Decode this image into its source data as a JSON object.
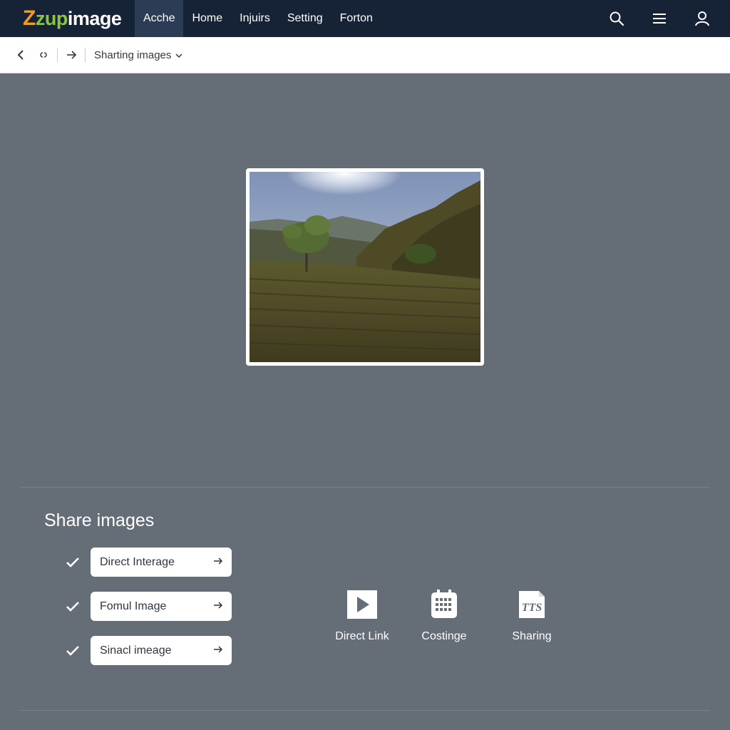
{
  "app": {
    "logo_z": "Z",
    "logo_zup": "zup",
    "logo_image": "image",
    "colors": {
      "topbar": "#162236",
      "active_tab": "#2c3c55",
      "logo_orange": "#f39a1e",
      "logo_green": "#8cc63f",
      "background": "#656d77"
    }
  },
  "nav": {
    "items": [
      {
        "label": "Acche",
        "active": true
      },
      {
        "label": "Home",
        "active": false
      },
      {
        "label": "Injuirs",
        "active": false
      },
      {
        "label": "Setting",
        "active": false
      },
      {
        "label": "Forton",
        "active": false
      }
    ],
    "icons": [
      "search-icon",
      "menu-icon",
      "user-icon"
    ]
  },
  "toolbar": {
    "icons": [
      "back-arrow-icon",
      "link-icon",
      "forward-arrow-icon"
    ],
    "breadcrumb": "Sharting images"
  },
  "share": {
    "title": "Share images",
    "options": [
      {
        "label": "Direct Interage",
        "checked": true
      },
      {
        "label": "Fomul Image",
        "checked": true
      },
      {
        "label": "Sinacl imeage",
        "checked": true
      }
    ],
    "actions": [
      {
        "label": "Direct Link",
        "icon": "play-icon"
      },
      {
        "label": "Costinge",
        "icon": "calendar-grid-icon"
      },
      {
        "label": "Sharing",
        "icon": "document-text-icon",
        "icon_text": "TTS"
      }
    ]
  }
}
